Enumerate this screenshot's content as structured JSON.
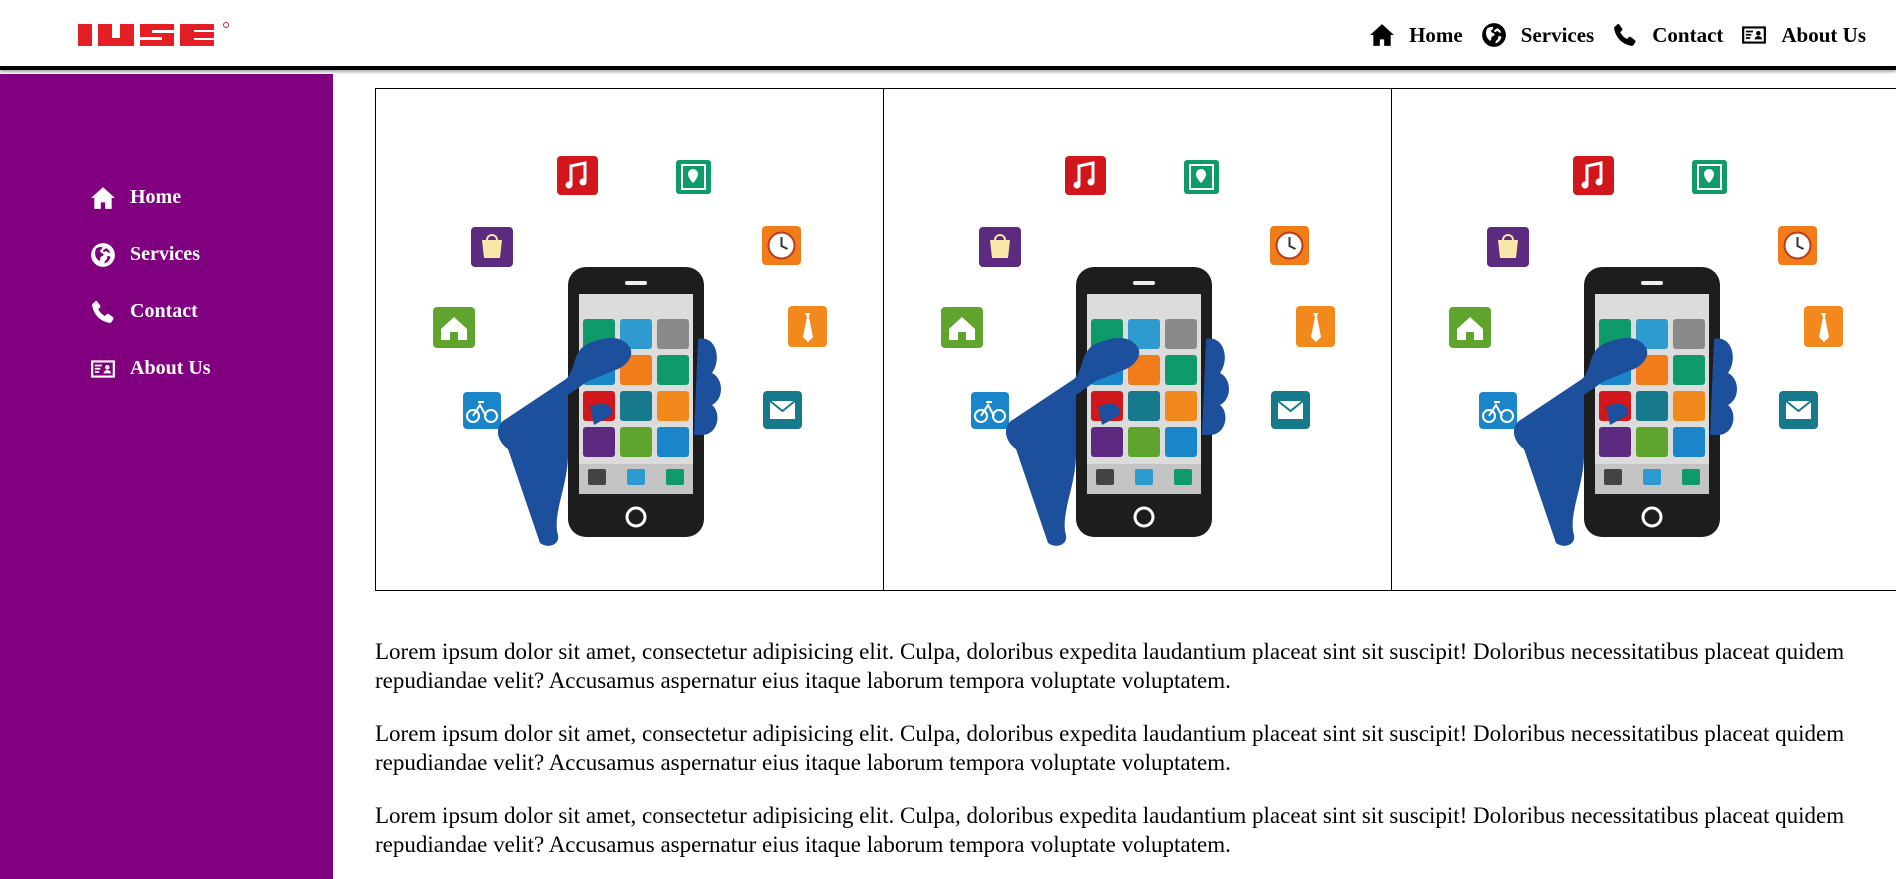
{
  "header": {
    "logo_text": "IJSE",
    "nav": [
      {
        "label": "Home",
        "icon": "home-icon"
      },
      {
        "label": "Services",
        "icon": "globe-icon"
      },
      {
        "label": "Contact",
        "icon": "phone-icon"
      },
      {
        "label": "About Us",
        "icon": "id-card-icon"
      }
    ]
  },
  "sidebar": {
    "items": [
      {
        "label": "Home",
        "icon": "home-icon"
      },
      {
        "label": "Services",
        "icon": "globe-icon"
      },
      {
        "label": "Contact",
        "icon": "phone-icon"
      },
      {
        "label": "About Us",
        "icon": "id-card-icon"
      }
    ]
  },
  "gallery": {
    "images": [
      {
        "icon": "mobile-apps-illustration"
      },
      {
        "icon": "mobile-apps-illustration"
      },
      {
        "icon": "mobile-apps-illustration"
      }
    ]
  },
  "content": {
    "paragraphs": [
      "Lorem ipsum dolor sit amet, consectetur adipisicing elit. Culpa, doloribus expedita laudantium placeat sint sit suscipit! Doloribus necessitatibus placeat quidem repudiandae velit? Accusamus aspernatur eius itaque laborum tempora voluptate voluptatem.",
      "Lorem ipsum dolor sit amet, consectetur adipisicing elit. Culpa, doloribus expedita laudantium placeat sint sit suscipit! Doloribus necessitatibus placeat quidem repudiandae velit? Accusamus aspernatur eius itaque laborum tempora voluptate voluptatem.",
      "Lorem ipsum dolor sit amet, consectetur adipisicing elit. Culpa, doloribus expedita laudantium placeat sint sit suscipit! Doloribus necessitatibus placeat quidem repudiandae velit? Accusamus aspernatur eius itaque laborum tempora voluptate voluptatem."
    ]
  },
  "colors": {
    "sidebar_bg": "#800080",
    "logo_red": "#e31e24",
    "header_border": "#000000"
  }
}
